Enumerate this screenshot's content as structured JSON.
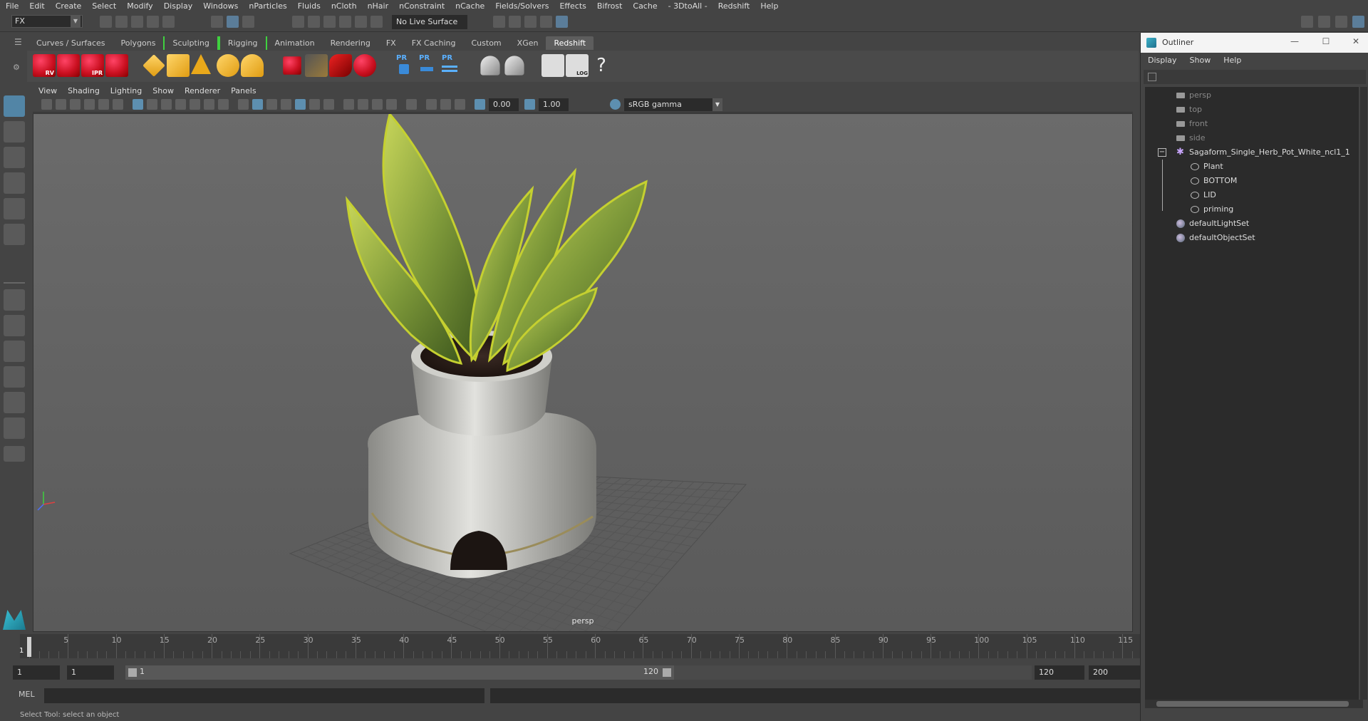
{
  "menubar": [
    "File",
    "Edit",
    "Create",
    "Select",
    "Modify",
    "Display",
    "Windows",
    "nParticles",
    "Fluids",
    "nCloth",
    "nHair",
    "nConstraint",
    "nCache",
    "Fields/Solvers",
    "Effects",
    "Bifrost",
    "Cache",
    "- 3DtoAll -",
    "Redshift",
    "Help"
  ],
  "statusline": {
    "mode": "FX",
    "live_surface": "No Live Surface"
  },
  "shelf_tabs": [
    {
      "label": "Curves / Surfaces"
    },
    {
      "label": "Polygons"
    },
    {
      "label": "Sculpting"
    },
    {
      "label": "Rigging"
    },
    {
      "label": "Animation"
    },
    {
      "label": "Rendering"
    },
    {
      "label": "FX"
    },
    {
      "label": "FX Caching"
    },
    {
      "label": "Custom"
    },
    {
      "label": "XGen"
    },
    {
      "label": "Redshift"
    }
  ],
  "shelf_labels": {
    "rv": "RV",
    "ipr": "IPR",
    "pr": "PR",
    "log": "LOG",
    "help": "?"
  },
  "viewport_menu": [
    "View",
    "Shading",
    "Lighting",
    "Show",
    "Renderer",
    "Panels"
  ],
  "viewport_toolbar": {
    "exposure": "0.00",
    "gamma": "1.00",
    "colorspace": "sRGB gamma"
  },
  "viewport": {
    "camera_label": "persp"
  },
  "timeline": {
    "ticks": [
      5,
      10,
      15,
      20,
      25,
      30,
      35,
      40,
      45,
      50,
      55,
      60,
      65,
      70,
      75,
      80,
      85,
      90,
      95,
      100,
      105,
      110,
      115
    ],
    "current_frame": "1"
  },
  "range": {
    "start": "1",
    "playback_start": "1",
    "slider_start": "1",
    "slider_end": "120",
    "playback_end": "120",
    "end": "200"
  },
  "command_line": {
    "label": "MEL"
  },
  "help_line": "Select Tool: select an object",
  "outliner": {
    "title": "Outliner",
    "menu": [
      "Display",
      "Show",
      "Help"
    ],
    "items": [
      {
        "label": "persp",
        "icon": "camera"
      },
      {
        "label": "top",
        "icon": "camera"
      },
      {
        "label": "front",
        "icon": "camera"
      },
      {
        "label": "side",
        "icon": "camera"
      },
      {
        "label": "Sagaform_Single_Herb_Pot_White_ncl1_1",
        "icon": "group"
      },
      {
        "label": "Plant",
        "icon": "transform"
      },
      {
        "label": "BOTTOM",
        "icon": "transform"
      },
      {
        "label": "LID",
        "icon": "transform"
      },
      {
        "label": "priming",
        "icon": "transform"
      },
      {
        "label": "defaultLightSet",
        "icon": "set"
      },
      {
        "label": "defaultObjectSet",
        "icon": "set"
      }
    ]
  },
  "colors": {
    "accent": "#5285a6",
    "shelf_bracket": "#3fd13f",
    "viewport_bg": "#666666",
    "redshift_red": "#cc1122"
  }
}
